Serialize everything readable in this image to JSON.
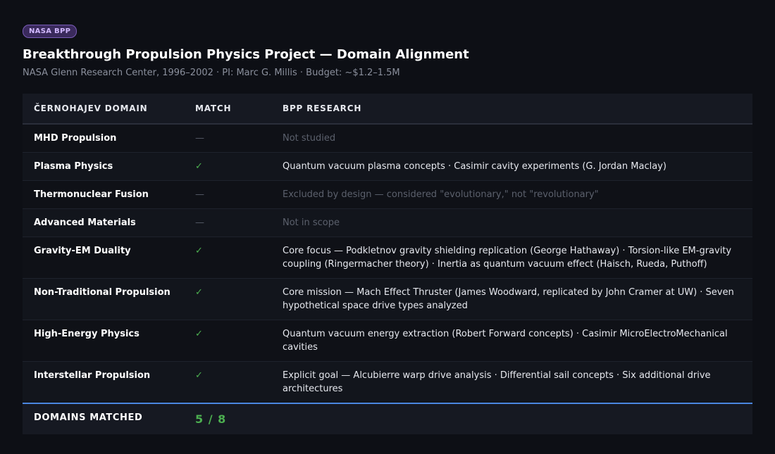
{
  "header": {
    "badge": "NASA BPP",
    "title": "Breakthrough Propulsion Physics Project — Domain Alignment",
    "subtitle": "NASA Glenn Research Center, 1996–2002 · PI: Marc G. Millis · Budget: ~$1.2–1.5M"
  },
  "table": {
    "columns": [
      "ČERNOHAJEV DOMAIN",
      "MATCH",
      "BPP RESEARCH"
    ],
    "rows": [
      {
        "domain": "MHD Propulsion",
        "match": "—",
        "matched": false,
        "research": "Not studied"
      },
      {
        "domain": "Plasma Physics",
        "match": "✓",
        "matched": true,
        "research": "Quantum vacuum plasma concepts · Casimir cavity experiments (G. Jordan Maclay)"
      },
      {
        "domain": "Thermonuclear Fusion",
        "match": "—",
        "matched": false,
        "research": "Excluded by design — considered \"evolutionary,\" not \"revolutionary\""
      },
      {
        "domain": "Advanced Materials",
        "match": "—",
        "matched": false,
        "research": "Not in scope"
      },
      {
        "domain": "Gravity-EM Duality",
        "match": "✓",
        "matched": true,
        "research": "Core focus — Podkletnov gravity shielding replication (George Hathaway) · Torsion-like EM-gravity coupling (Ringermacher theory) · Inertia as quantum vacuum effect (Haisch, Rueda, Puthoff)"
      },
      {
        "domain": "Non-Traditional Propulsion",
        "match": "✓",
        "matched": true,
        "research": "Core mission — Mach Effect Thruster (James Woodward, replicated by John Cramer at UW) · Seven hypothetical space drive types analyzed"
      },
      {
        "domain": "High-Energy Physics",
        "match": "✓",
        "matched": true,
        "research": "Quantum vacuum energy extraction (Robert Forward concepts) · Casimir MicroElectroMechanical cavities"
      },
      {
        "domain": "Interstellar Propulsion",
        "match": "✓",
        "matched": true,
        "research": "Explicit goal — Alcubierre warp drive analysis · Differential sail concepts · Six additional drive architectures"
      }
    ],
    "footer": {
      "label": "DOMAINS MATCHED",
      "value": "5 / 8"
    }
  },
  "colors": {
    "match": "#4caf50",
    "accent": "#4a86e0",
    "badge": "#3a2a5c"
  }
}
